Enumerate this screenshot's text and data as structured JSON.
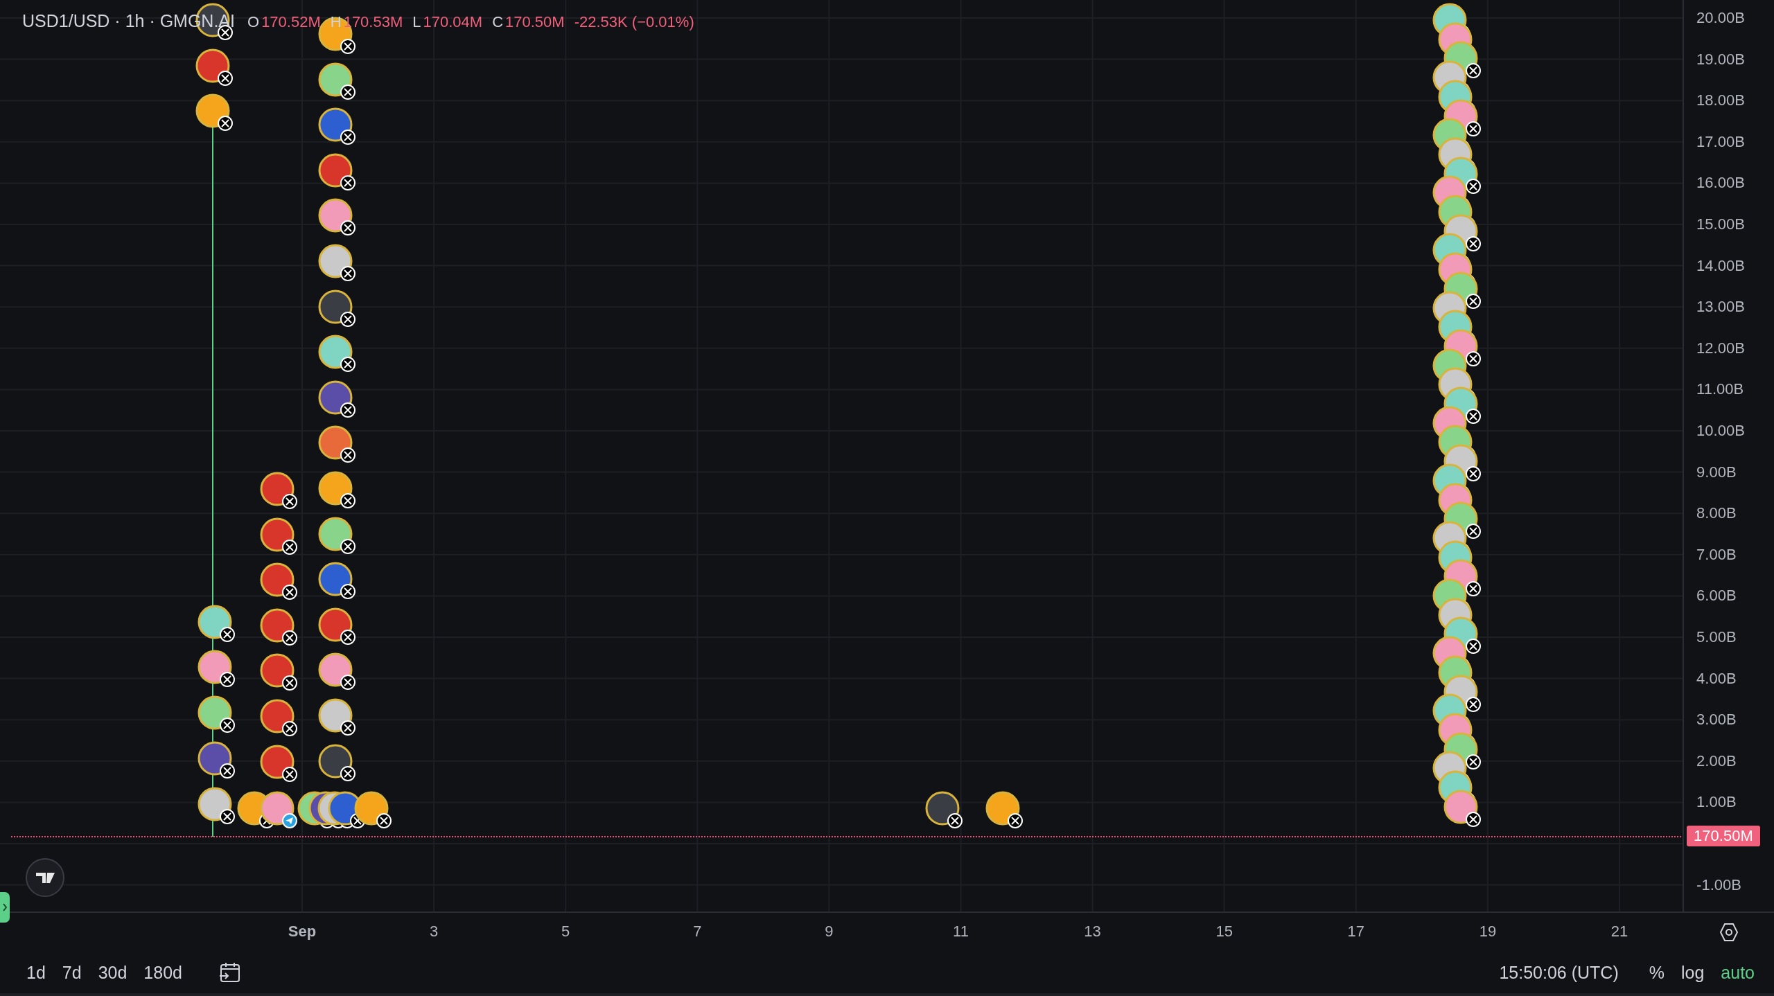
{
  "legend": {
    "symbol": "USD1/USD · 1h · GMGN.AI",
    "ohlc": [
      {
        "label": "O",
        "value": "170.52M"
      },
      {
        "label": "H",
        "value": "170.53M"
      },
      {
        "label": "L",
        "value": "170.04M"
      },
      {
        "label": "C",
        "value": "170.50M"
      }
    ],
    "change": "-22.53K (−0.01%)"
  },
  "y_axis": {
    "labels": [
      "20.00B",
      "19.00B",
      "18.00B",
      "17.00B",
      "16.00B",
      "15.00B",
      "14.00B",
      "13.00B",
      "12.00B",
      "11.00B",
      "10.00B",
      "9.00B",
      "8.00B",
      "7.00B",
      "6.00B",
      "5.00B",
      "4.00B",
      "3.00B",
      "2.00B",
      "1.00B"
    ],
    "below_labels": [
      "-1.00B"
    ],
    "price_label": "170.50M"
  },
  "x_axis": {
    "labels": [
      {
        "text": "Sep",
        "bold": true
      },
      {
        "text": "3",
        "bold": false
      },
      {
        "text": "5",
        "bold": false
      },
      {
        "text": "7",
        "bold": false
      },
      {
        "text": "9",
        "bold": false
      },
      {
        "text": "11",
        "bold": false
      },
      {
        "text": "13",
        "bold": false
      },
      {
        "text": "15",
        "bold": false
      },
      {
        "text": "17",
        "bold": false
      },
      {
        "text": "19",
        "bold": false
      },
      {
        "text": "21",
        "bold": false
      }
    ]
  },
  "ranges": [
    "1d",
    "7d",
    "30d",
    "180d"
  ],
  "clock": "15:50:06 (UTC)",
  "scale_options": [
    {
      "label": "%",
      "selected": false
    },
    {
      "label": "log",
      "selected": false
    },
    {
      "label": "auto",
      "selected": true
    }
  ]
}
